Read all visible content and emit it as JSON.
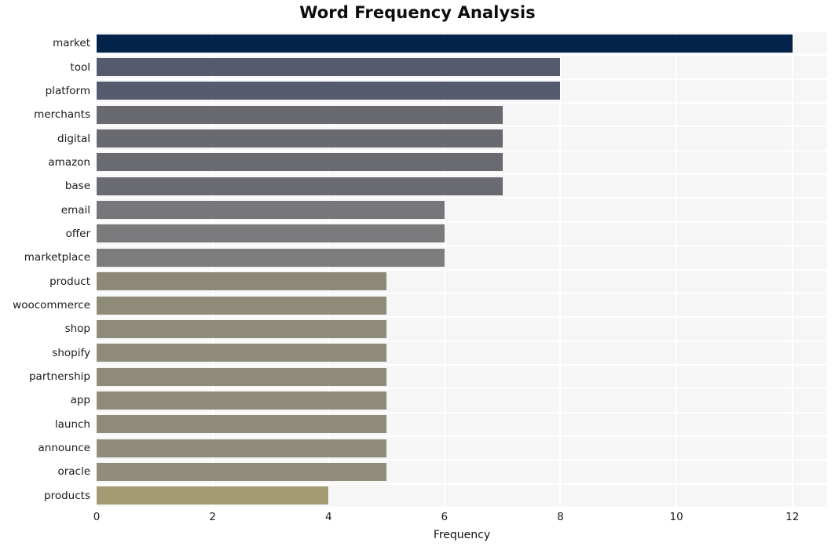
{
  "chart_data": {
    "type": "bar",
    "orientation": "horizontal",
    "title": "Word Frequency Analysis",
    "xlabel": "Frequency",
    "ylabel": "",
    "xlim": [
      0,
      12.6
    ],
    "ylim": [
      0,
      20
    ],
    "xticks": [
      0,
      2,
      4,
      6,
      8,
      10,
      12
    ],
    "xtick_labels": [
      "0",
      "2",
      "4",
      "6",
      "8",
      "10",
      "12"
    ],
    "grid": true,
    "grid_color": "#ffffff",
    "plot_background": "#f6f6f7",
    "figure_background": "#ffffff",
    "legend": null,
    "categories": [
      "market",
      "tool",
      "platform",
      "merchants",
      "digital",
      "amazon",
      "base",
      "email",
      "offer",
      "marketplace",
      "product",
      "woocommerce",
      "shop",
      "shopify",
      "partnership",
      "app",
      "launch",
      "announce",
      "oracle",
      "products"
    ],
    "values": [
      12,
      8,
      8,
      7,
      7,
      7,
      7,
      6,
      6,
      6,
      5,
      5,
      5,
      5,
      5,
      5,
      5,
      5,
      5,
      4
    ],
    "bar_colors": [
      "#03234b",
      "#565a6e",
      "#565b6f",
      "#686a70",
      "#686a70",
      "#6a6b71",
      "#6a6b72",
      "#77767a",
      "#7a797b",
      "#7d7c7d",
      "#8d8977",
      "#8f8b79",
      "#8f8b79",
      "#8f8b79",
      "#8f8b79",
      "#8f8b79",
      "#8f8b79",
      "#908c7a",
      "#918d7b",
      "#a39b72"
    ],
    "series": [
      {
        "name": "Frequency",
        "values": [
          12,
          8,
          8,
          7,
          7,
          7,
          7,
          6,
          6,
          6,
          5,
          5,
          5,
          5,
          5,
          5,
          5,
          5,
          5,
          4
        ]
      }
    ]
  }
}
